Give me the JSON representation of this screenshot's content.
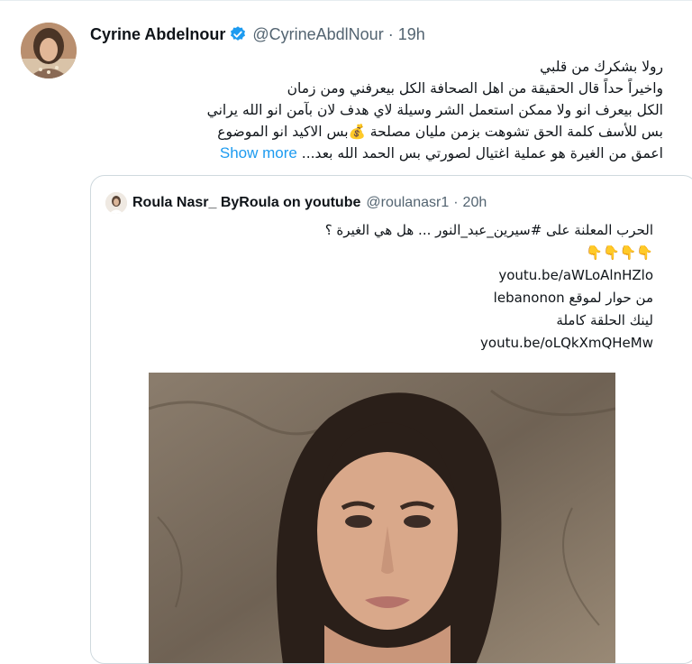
{
  "tweet": {
    "author_name": "Cyrine Abdelnour",
    "handle": "@CyrineAbdlNour",
    "time": "19h",
    "lines": [
      "رولا بشكرك من قلبي",
      "واخيراً حداً قال الحقيقة من اهل الصحافة الكل بيعرفني ومن زمان",
      "الكل بيعرف انو ولا ممكن استعمل الشر وسيلة لاي هدف لان بآمن انو الله يراني",
      "بس للأسف كلمة الحق تشوهت بزمن مليان مصلحة 💰بس الاكيد انو الموضوع",
      "اعمق من الغيرة هو عملية اغتيال لصورتي بس الحمد الله بعد..."
    ],
    "show_more": "Show more",
    "verified_icon": "verified-badge-icon",
    "accent_color": "#1d9bf0"
  },
  "quoted": {
    "author_name": "Roula Nasr_ ByRoula on youtube",
    "handle": "@roulanasr1",
    "time": "20h",
    "lines": [
      "الحرب المعلنة على #سيرين_عبد_النور ... هل هي الغيرة ؟",
      "👇👇👇👇",
      "youtu.be/aWLoAlnHZlo",
      "من حوار لموقع lebanonon",
      "لينك الحلقة كاملة",
      "youtu.be/oLQkXmQHeMw"
    ]
  }
}
